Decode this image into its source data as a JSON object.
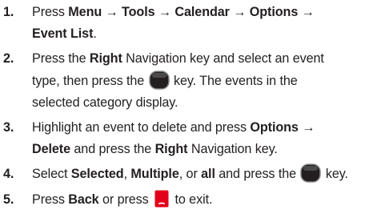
{
  "steps": [
    {
      "number": "1.",
      "lines": [
        [
          "Press ",
          {
            "b": "Menu"
          },
          " → ",
          {
            "b": "Tools"
          },
          " → ",
          {
            "b": "Calendar"
          },
          " → ",
          {
            "b": "Options"
          },
          " →"
        ],
        [
          {
            "b": "Event List"
          },
          "."
        ]
      ]
    },
    {
      "number": "2.",
      "lines": [
        [
          "Press the ",
          {
            "b": "Right"
          },
          " Navigation key and select an event"
        ],
        [
          "type, then press the ",
          {
            "icon": "ok-key-icon"
          },
          " key. The events in the"
        ],
        [
          "selected category display."
        ]
      ]
    },
    {
      "number": "3.",
      "lines": [
        [
          "Highlight an event to delete and press ",
          {
            "b": "Options"
          },
          " →"
        ],
        [
          {
            "b": "Delete"
          },
          " and press the ",
          {
            "b": "Right"
          },
          " Navigation key."
        ]
      ]
    },
    {
      "number": "4.",
      "lines": [
        [
          "Select ",
          {
            "b": "Selected"
          },
          ", ",
          {
            "b": "Multiple"
          },
          ", or ",
          {
            "b": "all"
          },
          " and press the ",
          {
            "icon": "ok-key-icon"
          },
          " key."
        ]
      ]
    },
    {
      "number": "5.",
      "lines": [
        [
          "Press ",
          {
            "b": "Back"
          },
          " or press ",
          {
            "icon": "end-key-icon"
          },
          " to exit."
        ]
      ]
    }
  ]
}
